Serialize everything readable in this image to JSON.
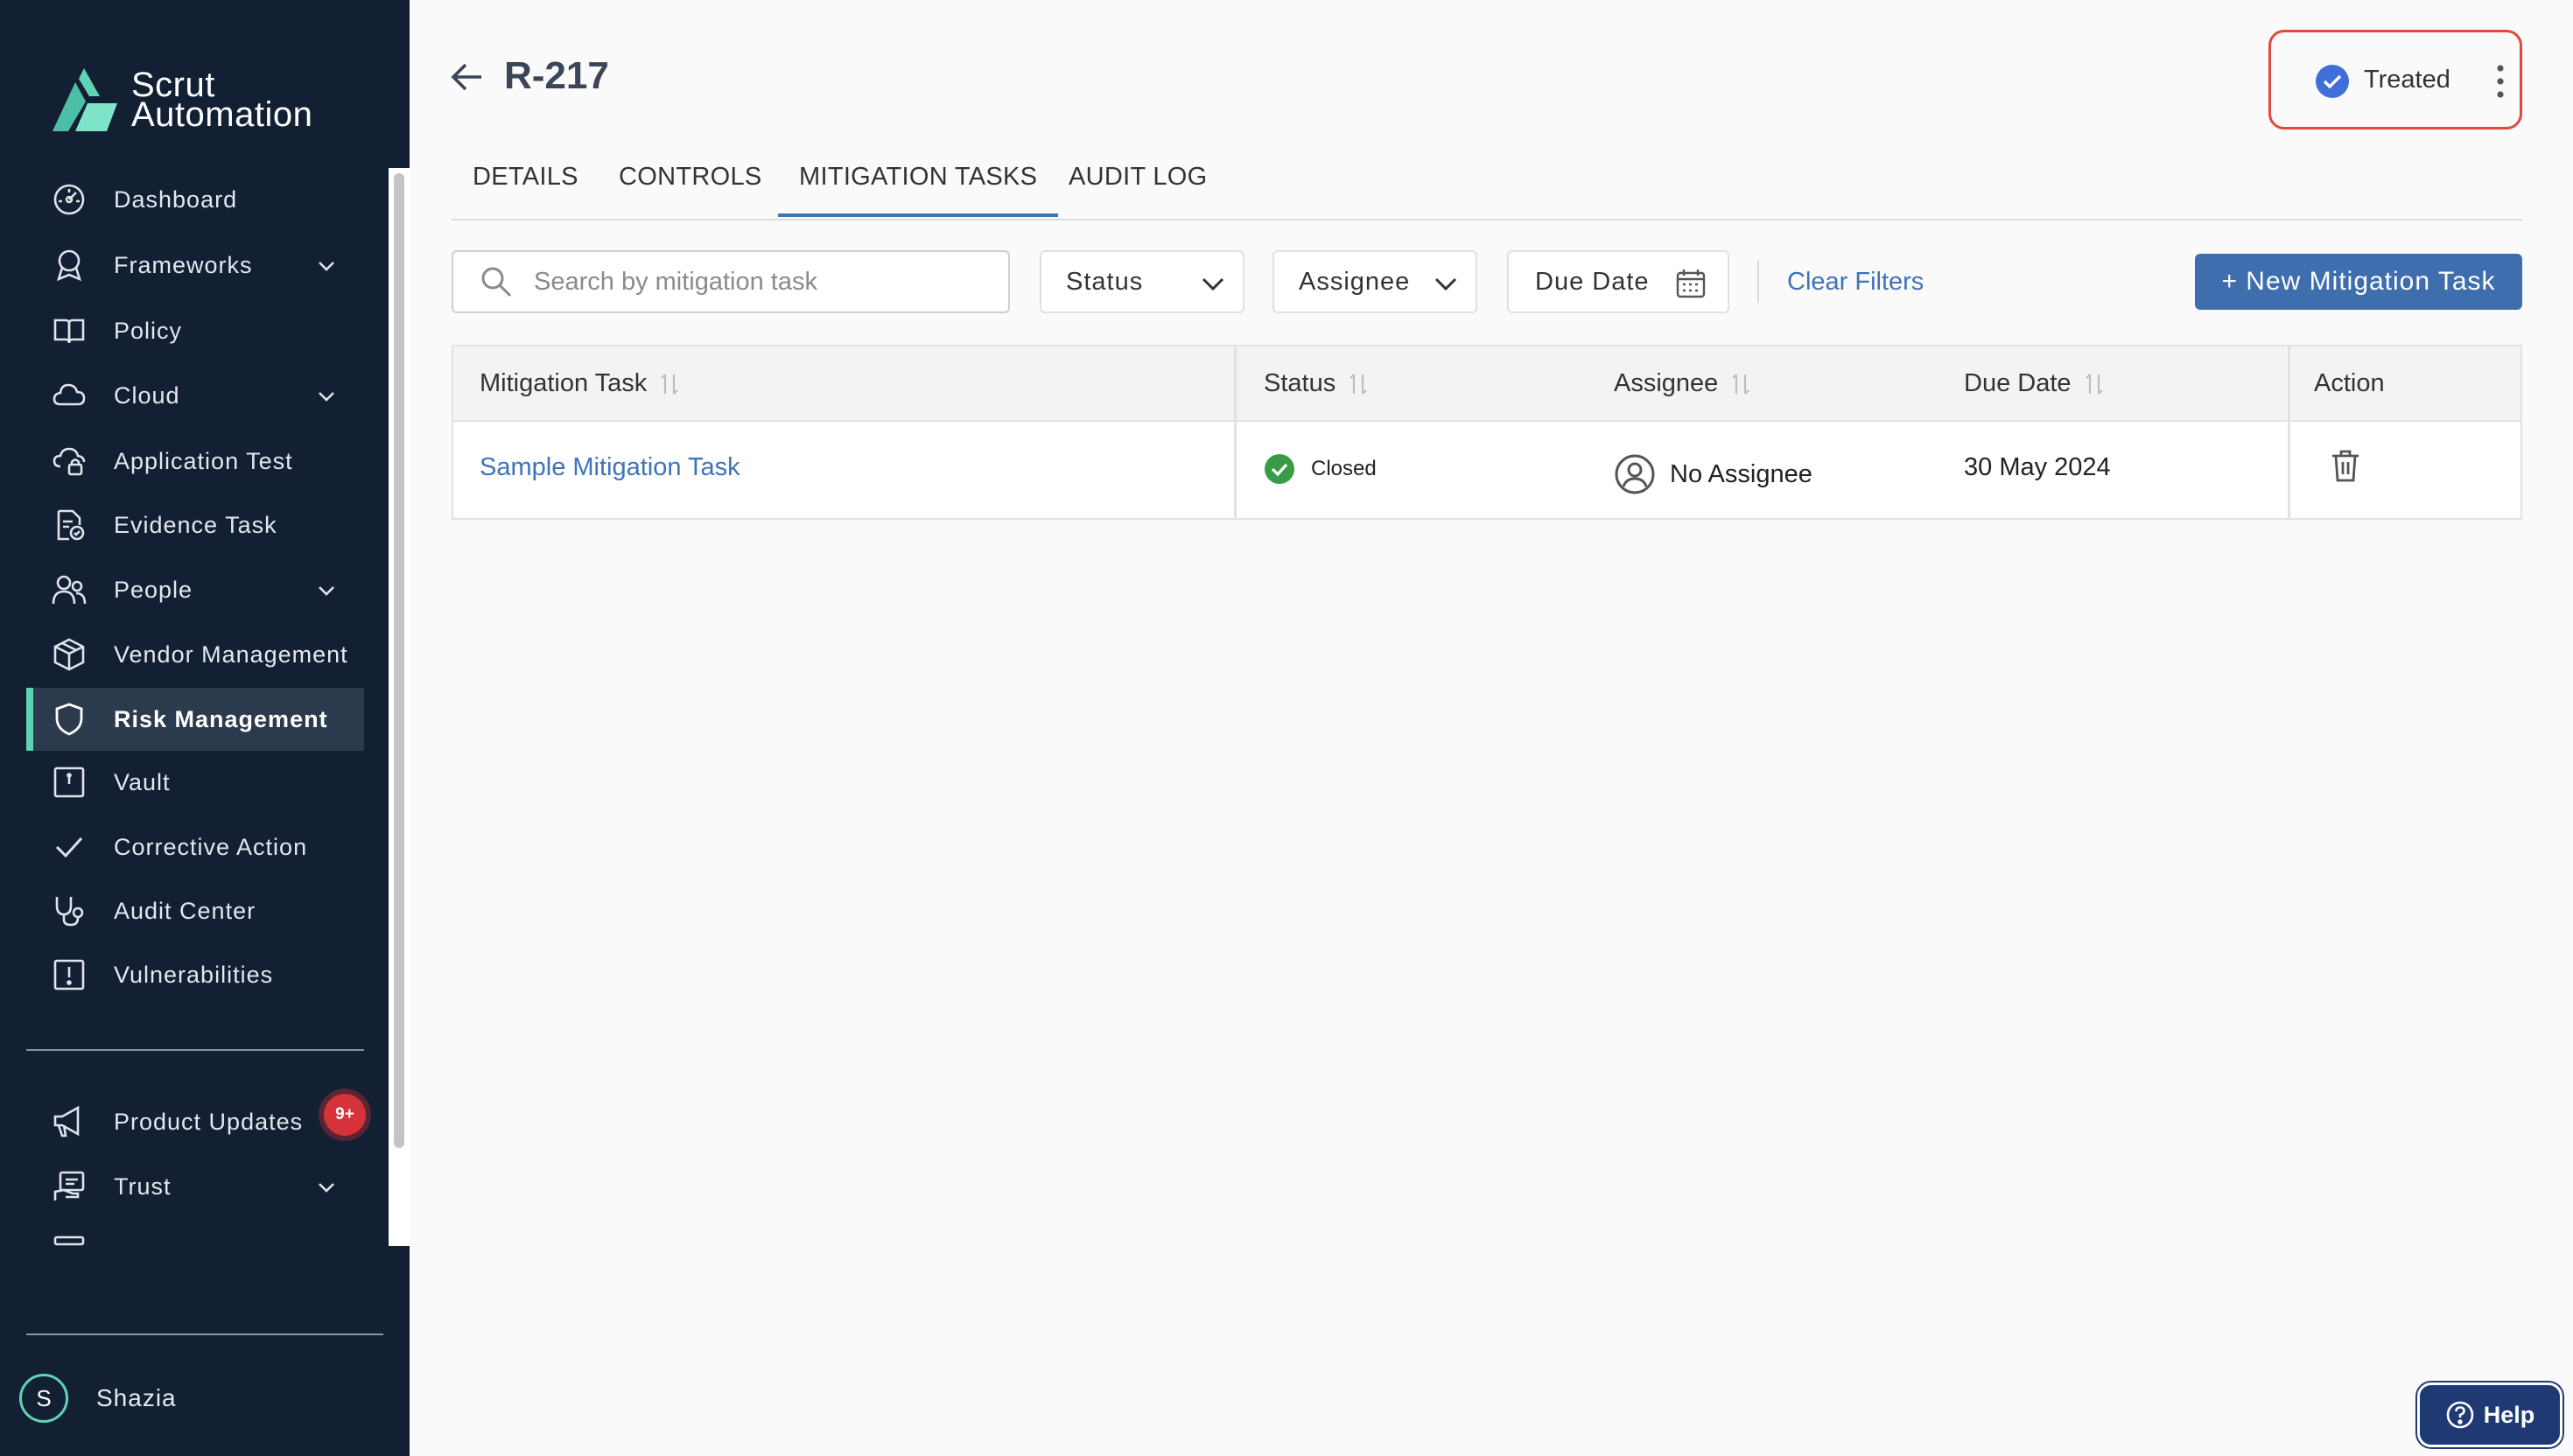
{
  "brand": {
    "name_line1": "Scrut",
    "name_line2": "Automation",
    "accent": "#5fd3b4"
  },
  "sidebar": {
    "items": [
      {
        "label": "Dashboard",
        "icon": "dashboard-icon"
      },
      {
        "label": "Frameworks",
        "icon": "award-icon",
        "expandable": true
      },
      {
        "label": "Policy",
        "icon": "book-icon"
      },
      {
        "label": "Cloud",
        "icon": "cloud-icon",
        "expandable": true
      },
      {
        "label": "Application Test",
        "icon": "cloud-lock-icon"
      },
      {
        "label": "Evidence Task",
        "icon": "document-check-icon"
      },
      {
        "label": "People",
        "icon": "people-icon",
        "expandable": true
      },
      {
        "label": "Vendor Management",
        "icon": "box-icon"
      },
      {
        "label": "Risk Management",
        "icon": "shield-icon",
        "active": true
      },
      {
        "label": "Vault",
        "icon": "vault-icon"
      },
      {
        "label": "Corrective Action",
        "icon": "check-icon"
      },
      {
        "label": "Audit Center",
        "icon": "stethoscope-icon"
      },
      {
        "label": "Vulnerabilities",
        "icon": "alert-box-icon"
      }
    ],
    "lower_items": [
      {
        "label": "Product Updates",
        "icon": "megaphone-icon",
        "badge": "9+"
      },
      {
        "label": "Trust",
        "icon": "trust-icon",
        "expandable": true
      }
    ],
    "user": {
      "initial": "S",
      "name": "Shazia"
    }
  },
  "header": {
    "title": "R-217",
    "status": "Treated"
  },
  "tabs": [
    {
      "label": "DETAILS"
    },
    {
      "label": "CONTROLS"
    },
    {
      "label": "MITIGATION TASKS",
      "active": true
    },
    {
      "label": "AUDIT LOG"
    }
  ],
  "filters": {
    "search_placeholder": "Search by mitigation task",
    "status_label": "Status",
    "assignee_label": "Assignee",
    "due_date_label": "Due Date",
    "clear_label": "Clear Filters",
    "new_button": "+ New Mitigation Task"
  },
  "table": {
    "headers": [
      "Mitigation Task",
      "Status",
      "Assignee",
      "Due Date",
      "Action"
    ],
    "rows": [
      {
        "task": "Sample Mitigation Task",
        "status": "Closed",
        "assignee": "No Assignee",
        "due_date": "30 May 2024"
      }
    ]
  },
  "help": {
    "label": "Help"
  },
  "colors": {
    "primary": "#3e6ead",
    "link": "#3e73b8",
    "status_closed": "#3a9b46",
    "highlight": "#e2473c",
    "sidebar_bg": "#132033"
  }
}
